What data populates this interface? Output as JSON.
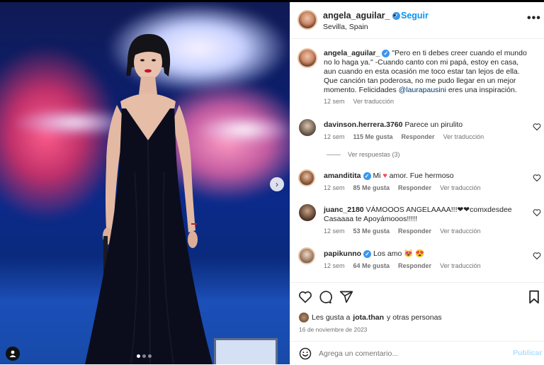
{
  "post": {
    "username": "angela_aguilar_",
    "separator": "•",
    "follow_label": "Seguir",
    "location": "Sevilla, Spain",
    "more_label": "•••"
  },
  "media": {
    "next_label": "›",
    "slide_count": 3,
    "active_slide": 1
  },
  "caption": {
    "username": "angela_aguilar_",
    "text_before": "\"Pero en ti debes creer cuando el mundo no lo haga ya.\" -Cuando canto con mi papá, estoy en casa, aun cuando en esta ocasión me toco estar tan lejos de ella. Que canción tan poderosa, no me pudo llegar en un mejor momento. Felicidades ",
    "mention": "@laurapausini",
    "text_after": " eres una inspiración.",
    "time": "12 sem",
    "translate": "Ver traducción"
  },
  "comments": [
    {
      "username": "davinson.herrera.3760",
      "text": "Parece un pirulito",
      "time": "12 sem",
      "likes": "115 Me gusta",
      "reply": "Responder",
      "translate": "Ver traducción",
      "replies": "Ver respuestas (3)"
    },
    {
      "username": "amanditita",
      "verified": true,
      "text_a": "Mi ",
      "text_b": " amor. Fue hermoso",
      "time": "12 sem",
      "likes": "85 Me gusta",
      "reply": "Responder",
      "translate": "Ver traducción"
    },
    {
      "username": "juanc_2180",
      "text": "VÁMOOOS ANGELAAAA!!!❤❤comxdesdee Casaaaa te Apoyámooos!!!!!",
      "time": "12 sem",
      "likes": "53 Me gusta",
      "reply": "Responder",
      "translate": "Ver traducción"
    },
    {
      "username": "papikunno",
      "verified": true,
      "text": "Los amo 😻 😍",
      "time": "12 sem",
      "likes": "64 Me gusta",
      "reply": "Responder",
      "translate": "Ver traducción"
    }
  ],
  "likes_line": {
    "prefix": "Les gusta a ",
    "user": "jota.than",
    "suffix": " y otras personas"
  },
  "date": "16 de noviembre de 2023",
  "composer": {
    "placeholder": "Agrega un comentario...",
    "post_label": "Publicar"
  },
  "colors": {
    "accent": "#0095f6",
    "verified": "#3897f0",
    "heart": "#ed4956",
    "muted": "#737373"
  }
}
